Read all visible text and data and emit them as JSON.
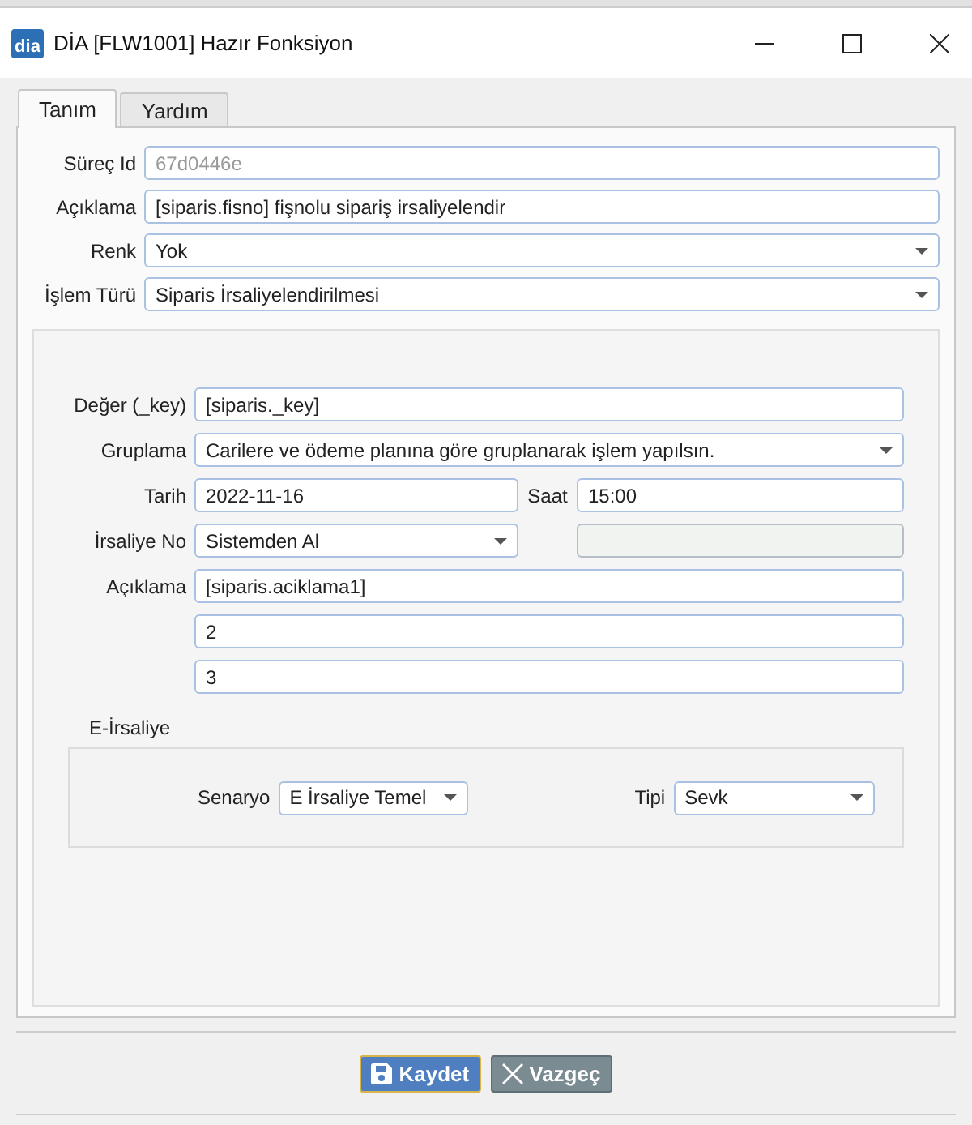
{
  "window": {
    "logo": "dia",
    "title": "DİA [FLW1001] Hazır Fonksiyon"
  },
  "tabs": [
    {
      "label": "Tanım",
      "selected": true
    },
    {
      "label": "Yardım",
      "selected": false
    }
  ],
  "fields": [
    {
      "label": "Süreç Id",
      "value": "67d0446e",
      "kind": "readonly"
    },
    {
      "label": "Açıklama",
      "value": "[siparis.fisno] fişnolu sipariş irsaliyelendir",
      "kind": "text"
    },
    {
      "label": "Renk",
      "value": "Yok",
      "kind": "select"
    },
    {
      "label": "İşlem Türü",
      "value": "Siparis İrsaliyelendirilmesi",
      "kind": "select"
    }
  ],
  "detail": {
    "rows": [
      {
        "label": "Değer (_key)",
        "items": [
          {
            "kind": "text",
            "value": "[siparis._key]"
          }
        ]
      },
      {
        "label": "Gruplama",
        "items": [
          {
            "kind": "select",
            "value": "Carilere ve ödeme planına göre gruplanarak işlem yapılsın."
          }
        ]
      },
      {
        "label": "Tarih",
        "items": [
          {
            "kind": "text",
            "value": "2022-11-16"
          },
          {
            "kind": "label",
            "value": "Saat"
          },
          {
            "kind": "text",
            "value": "15:00"
          }
        ]
      },
      {
        "label": "İrsaliye No",
        "items": [
          {
            "kind": "select",
            "value": "Sistemden Al"
          },
          {
            "kind": "disabled"
          }
        ]
      },
      {
        "label": "Açıklama",
        "items": [
          {
            "kind": "text",
            "value": "[siparis.aciklama1]"
          }
        ]
      },
      {
        "items": [
          {
            "kind": "text",
            "value": "2"
          }
        ]
      },
      {
        "items": [
          {
            "kind": "text",
            "value": "3"
          }
        ]
      }
    ],
    "e_irsaliye": {
      "title": "E-İrsaliye",
      "fields": [
        {
          "label": "Senaryo",
          "value": "E İrsaliye Temel",
          "kind": "select"
        },
        {
          "label": "Tipi",
          "value": "Sevk",
          "kind": "select"
        }
      ]
    }
  },
  "buttons": [
    {
      "label": "Kaydet",
      "kind": "save"
    },
    {
      "label": "Vazgeç",
      "kind": "cancel"
    }
  ]
}
